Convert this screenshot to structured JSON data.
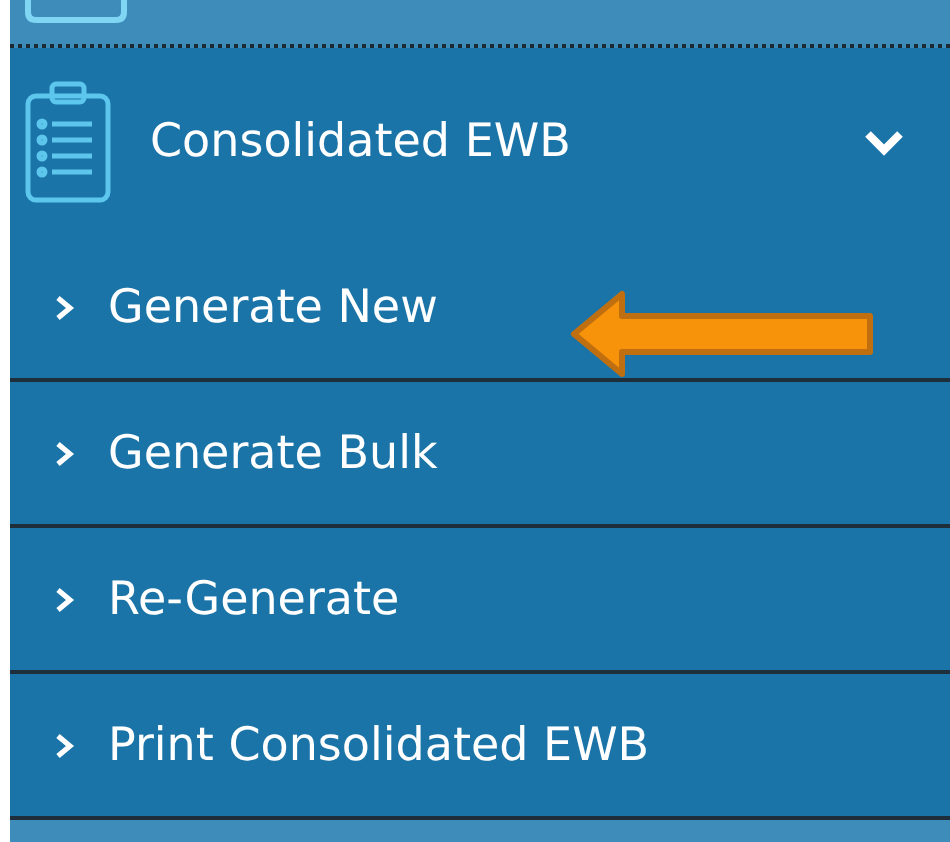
{
  "menu": {
    "label": "Consolidated EWB",
    "expanded": true,
    "children": [
      {
        "label": "Generate New"
      },
      {
        "label": "Generate Bulk"
      },
      {
        "label": "Re-Generate"
      },
      {
        "label": "Print Consolidated EWB"
      }
    ]
  }
}
